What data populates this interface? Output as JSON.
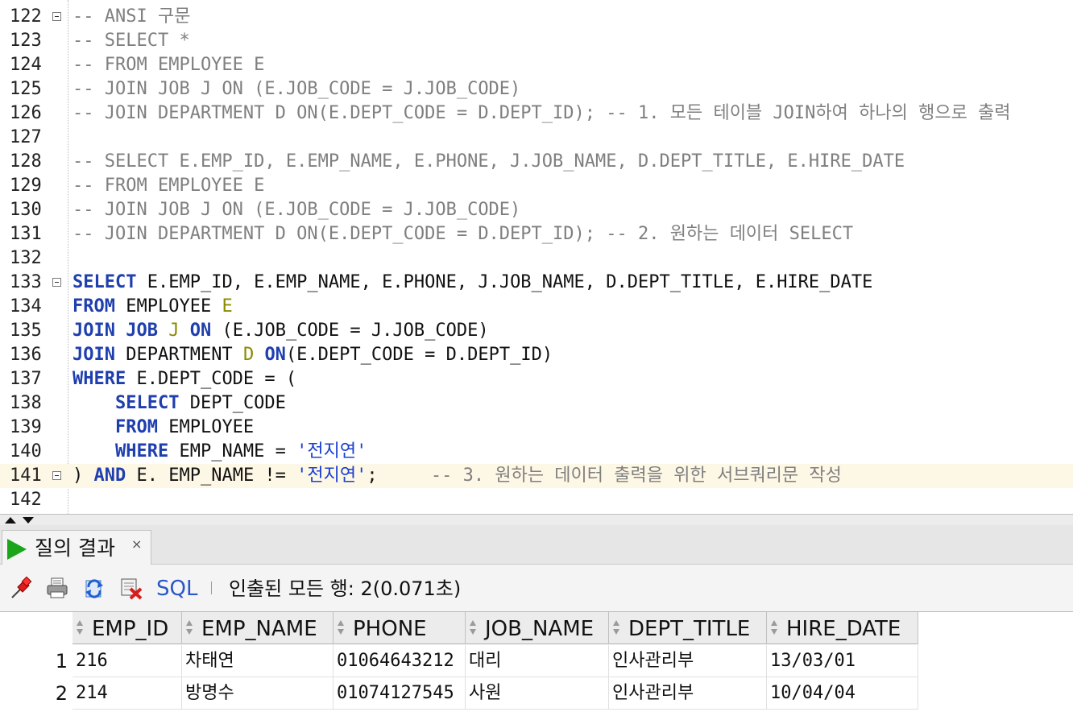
{
  "editor": {
    "lines": [
      {
        "num": "122",
        "fold": true,
        "hl": false,
        "tokens": [
          {
            "t": "cm",
            "s": "-- ANSI 구문"
          }
        ]
      },
      {
        "num": "123",
        "fold": false,
        "hl": false,
        "tokens": [
          {
            "t": "cm",
            "s": "-- SELECT *"
          }
        ]
      },
      {
        "num": "124",
        "fold": false,
        "hl": false,
        "tokens": [
          {
            "t": "cm",
            "s": "-- FROM EMPLOYEE E"
          }
        ]
      },
      {
        "num": "125",
        "fold": false,
        "hl": false,
        "tokens": [
          {
            "t": "cm",
            "s": "-- JOIN JOB J ON (E.JOB_CODE = J.JOB_CODE)"
          }
        ]
      },
      {
        "num": "126",
        "fold": false,
        "hl": false,
        "tokens": [
          {
            "t": "cm",
            "s": "-- JOIN DEPARTMENT D ON(E.DEPT_CODE = D.DEPT_ID); -- 1. 모든 테이블 JOIN하여 하나의 행으로 출력"
          }
        ]
      },
      {
        "num": "127",
        "fold": false,
        "hl": false,
        "tokens": []
      },
      {
        "num": "128",
        "fold": false,
        "hl": false,
        "tokens": [
          {
            "t": "cm",
            "s": "-- SELECT E.EMP_ID, E.EMP_NAME, E.PHONE, J.JOB_NAME, D.DEPT_TITLE, E.HIRE_DATE"
          }
        ]
      },
      {
        "num": "129",
        "fold": false,
        "hl": false,
        "tokens": [
          {
            "t": "cm",
            "s": "-- FROM EMPLOYEE E"
          }
        ]
      },
      {
        "num": "130",
        "fold": false,
        "hl": false,
        "tokens": [
          {
            "t": "cm",
            "s": "-- JOIN JOB J ON (E.JOB_CODE = J.JOB_CODE)"
          }
        ]
      },
      {
        "num": "131",
        "fold": false,
        "hl": false,
        "tokens": [
          {
            "t": "cm",
            "s": "-- JOIN DEPARTMENT D ON(E.DEPT_CODE = D.DEPT_ID); -- 2. 원하는 데이터 SELECT"
          }
        ]
      },
      {
        "num": "132",
        "fold": false,
        "hl": false,
        "tokens": []
      },
      {
        "num": "133",
        "fold": true,
        "hl": false,
        "tokens": [
          {
            "t": "kw",
            "s": "SELECT"
          },
          {
            "t": "tx",
            "s": " E.EMP_ID, E.EMP_NAME, E.PHONE, J.JOB_NAME, D.DEPT_TITLE, E.HIRE_DATE"
          }
        ]
      },
      {
        "num": "134",
        "fold": false,
        "hl": false,
        "tokens": [
          {
            "t": "kw",
            "s": "FROM"
          },
          {
            "t": "tx",
            "s": " EMPLOYEE "
          },
          {
            "t": "al",
            "s": "E"
          }
        ]
      },
      {
        "num": "135",
        "fold": false,
        "hl": false,
        "tokens": [
          {
            "t": "kw",
            "s": "JOIN"
          },
          {
            "t": "tx",
            "s": " "
          },
          {
            "t": "kw",
            "s": "JOB"
          },
          {
            "t": "tx",
            "s": " "
          },
          {
            "t": "al",
            "s": "J"
          },
          {
            "t": "tx",
            "s": " "
          },
          {
            "t": "kw",
            "s": "ON"
          },
          {
            "t": "tx",
            "s": " (E.JOB_CODE = J.JOB_CODE)"
          }
        ]
      },
      {
        "num": "136",
        "fold": false,
        "hl": false,
        "tokens": [
          {
            "t": "kw",
            "s": "JOIN"
          },
          {
            "t": "tx",
            "s": " DEPARTMENT "
          },
          {
            "t": "al",
            "s": "D"
          },
          {
            "t": "tx",
            "s": " "
          },
          {
            "t": "kw",
            "s": "ON"
          },
          {
            "t": "tx",
            "s": "(E.DEPT_CODE = D.DEPT_ID)"
          }
        ]
      },
      {
        "num": "137",
        "fold": false,
        "hl": false,
        "tokens": [
          {
            "t": "kw",
            "s": "WHERE"
          },
          {
            "t": "tx",
            "s": " E.DEPT_CODE = ("
          }
        ]
      },
      {
        "num": "138",
        "fold": false,
        "hl": false,
        "tokens": [
          {
            "t": "tx",
            "s": "    "
          },
          {
            "t": "kw",
            "s": "SELECT"
          },
          {
            "t": "tx",
            "s": " DEPT_CODE"
          }
        ]
      },
      {
        "num": "139",
        "fold": false,
        "hl": false,
        "tokens": [
          {
            "t": "tx",
            "s": "    "
          },
          {
            "t": "kw",
            "s": "FROM"
          },
          {
            "t": "tx",
            "s": " EMPLOYEE"
          }
        ]
      },
      {
        "num": "140",
        "fold": false,
        "hl": false,
        "tokens": [
          {
            "t": "tx",
            "s": "    "
          },
          {
            "t": "kw",
            "s": "WHERE"
          },
          {
            "t": "tx",
            "s": " EMP_NAME = "
          },
          {
            "t": "st",
            "s": "'전지연'"
          }
        ]
      },
      {
        "num": "141",
        "fold": true,
        "hl": true,
        "tokens": [
          {
            "t": "tx",
            "s": ") "
          },
          {
            "t": "kw",
            "s": "AND"
          },
          {
            "t": "tx",
            "s": " E. EMP_NAME != "
          },
          {
            "t": "st",
            "s": "'전지연'"
          },
          {
            "t": "tx",
            "s": ";     "
          },
          {
            "t": "cm",
            "s": "-- 3. 원하는 데이터 출력을 위한 서브쿼리문 작성"
          }
        ]
      },
      {
        "num": "142",
        "fold": false,
        "hl": false,
        "tokens": []
      }
    ]
  },
  "results_panel": {
    "tab_label": "질의 결과",
    "tab_close": "×",
    "toolbar": {
      "icons": [
        "pin-icon",
        "print-icon",
        "refresh-icon",
        "delete-icon"
      ],
      "sql_label": "SQL",
      "status": "인출된 모든 행: 2(0.071초)"
    },
    "columns": [
      "EMP_ID",
      "EMP_NAME",
      "PHONE",
      "JOB_NAME",
      "DEPT_TITLE",
      "HIRE_DATE"
    ],
    "rows": [
      {
        "num": "1",
        "cells": [
          "216",
          "차태연",
          "01064643212",
          "대리",
          "인사관리부",
          "13/03/01"
        ]
      },
      {
        "num": "2",
        "cells": [
          "214",
          "방명수",
          "01074127545",
          "사원",
          "인사관리부",
          "10/04/04"
        ]
      }
    ]
  },
  "colors": {
    "keyword": "#1f3fae",
    "comment": "#7f7f7f",
    "alias": "#8a8a00",
    "string": "#1a3fd0",
    "current_line": "#fdf7e6",
    "sql_link": "#2a56c6",
    "run_icon": "#1aa51a"
  }
}
